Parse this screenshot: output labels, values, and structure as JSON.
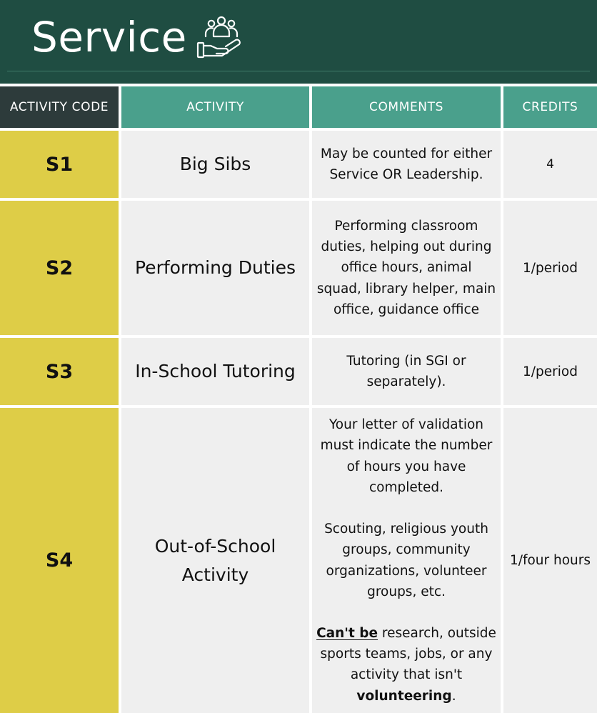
{
  "page": {
    "title": "Service",
    "icon": "community-service-hand-icon"
  },
  "columns": {
    "code": "ACTIVITY CODE",
    "activity": "ACTIVITY",
    "comments": "COMMENTS",
    "credits": "CREDITS"
  },
  "rows": [
    {
      "code": "S1",
      "activity_lines": [
        "Big Sibs"
      ],
      "comment_lines": [
        "May be counted for either",
        "Service OR Leadership."
      ],
      "credits": "4"
    },
    {
      "code": "S2",
      "activity_lines": [
        "Performing Duties"
      ],
      "comment_lines": [
        "Performing classroom",
        "duties, helping out during",
        "office hours, animal",
        "squad, library helper, main",
        "office, guidance office"
      ],
      "credits": "1/period"
    },
    {
      "code": "S3",
      "activity_lines": [
        "In-School Tutoring"
      ],
      "comment_lines": [
        "Tutoring (in SGI or",
        "separately)."
      ],
      "credits": "1/period"
    },
    {
      "code": "S4",
      "activity_lines": [
        "Out-of-School",
        "Activity"
      ],
      "comment_para1": [
        "Your letter of validation",
        "must indicate the number",
        "of hours you have",
        "completed."
      ],
      "comment_para2": [
        "Scouting, religious youth",
        "groups, community",
        "organizations, volunteer",
        "groups, etc."
      ],
      "comment_para3": {
        "underlined_lead": "Can't be",
        "line1_rest": " research, outside",
        "line2": "sports teams, jobs, or any",
        "line3": "activity that isn't",
        "bold_word": "volunteering",
        "end": "."
      },
      "credits": "1/four hours"
    }
  ],
  "colors": {
    "header_bg": "#1f4d42",
    "code_header_bg": "#2d3b3b",
    "column_header_bg": "#4aa08c",
    "code_cell_bg": "#decd47",
    "body_cell_bg": "#efefef"
  }
}
